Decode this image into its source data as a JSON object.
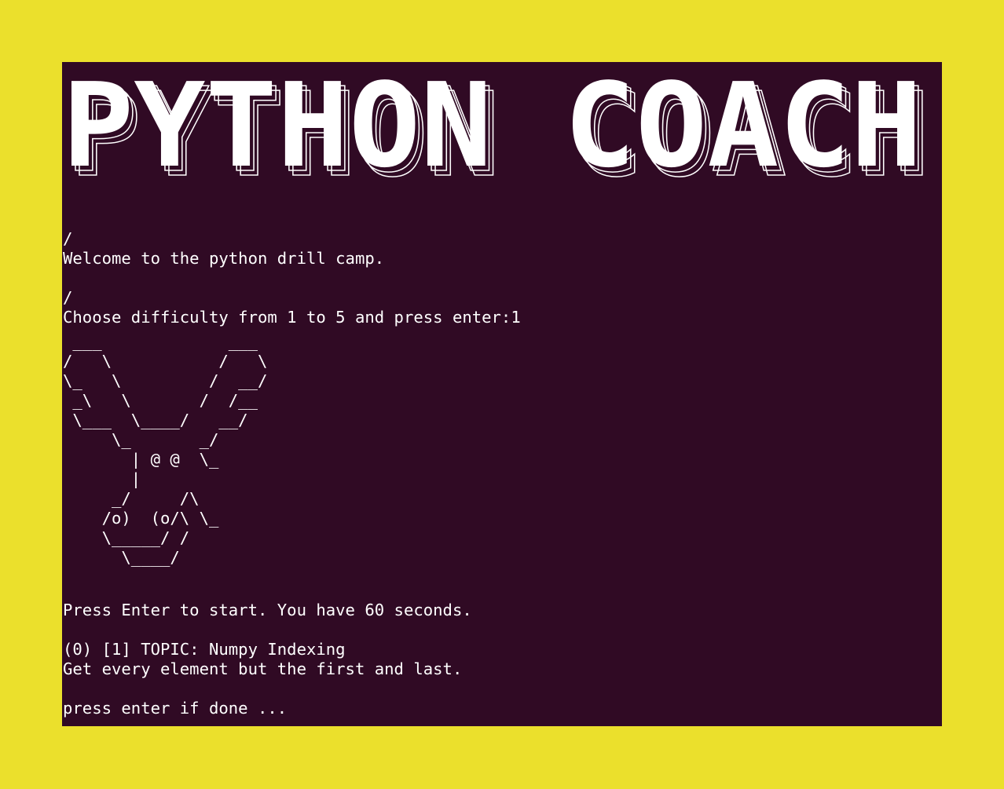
{
  "colors": {
    "page_background": "#ebe02c",
    "terminal_background": "#300a24",
    "terminal_foreground": "#ffffff"
  },
  "banner": {
    "text": "PYTHON COACH"
  },
  "terminal": {
    "lines": {
      "slash_1": "/",
      "welcome": "Welcome to the python drill camp.",
      "slash_2": "/",
      "difficulty_prompt": "Choose difficulty from 1 to 5 and press enter:1",
      "start_prompt": "Press Enter to start. You have 60 seconds.",
      "topic": "(0) [1] TOPIC: Numpy Indexing",
      "task": "Get every element but the first and last.",
      "done_prompt": "press enter if done ..."
    },
    "ascii_moose": " ___             ___\n/   \\           /   \\\n\\_   \\         /  __/\n _\\   \\       /  /__\n \\___  \\____/   __/\n     \\_       _/\n       | @ @  \\_\n       |\n     _/     /\\\n    /o)  (o/\\ \\_\n    \\_____/ /\n      \\____/"
  }
}
